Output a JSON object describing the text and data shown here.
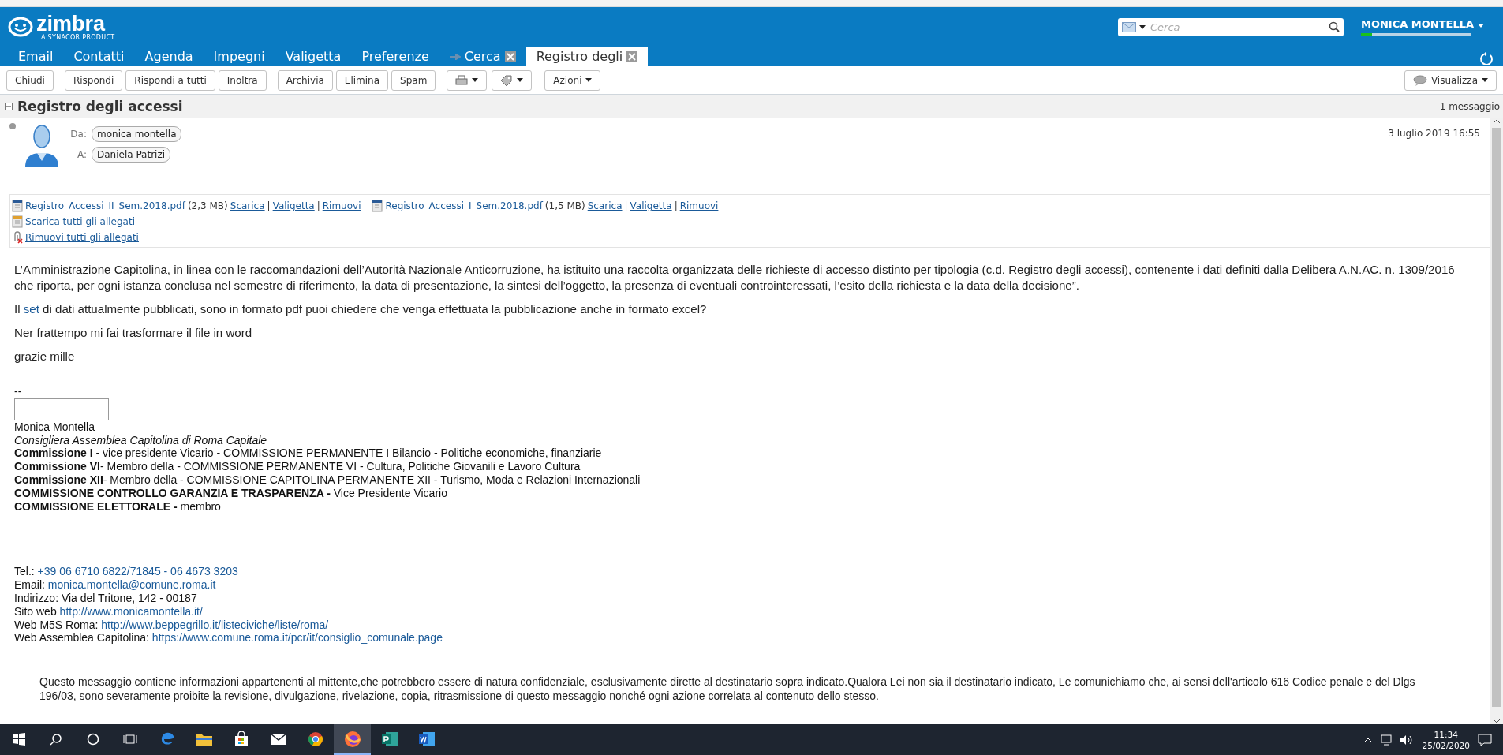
{
  "brand": {
    "name": "zimbra",
    "tagline": "A SYNACOR PRODUCT"
  },
  "search": {
    "placeholder": "Cerca"
  },
  "user": {
    "name": "MONICA MONTELLA",
    "level": 0.1
  },
  "tabs": [
    {
      "label": "Email",
      "selected": false,
      "kind": "app"
    },
    {
      "label": "Contatti",
      "selected": false,
      "kind": "app"
    },
    {
      "label": "Agenda",
      "selected": false,
      "kind": "app"
    },
    {
      "label": "Impegni",
      "selected": false,
      "kind": "app"
    },
    {
      "label": "Valigetta",
      "selected": false,
      "kind": "app"
    },
    {
      "label": "Preferenze",
      "selected": false,
      "kind": "app"
    },
    {
      "label": "Cerca",
      "selected": false,
      "kind": "search"
    },
    {
      "label": "Registro degli",
      "selected": true,
      "kind": "view"
    }
  ],
  "toolbar": {
    "groups": [
      [
        "Chiudi"
      ],
      [
        "Rispondi",
        "Rispondi a tutti",
        "Inoltra"
      ],
      [
        "Archivia",
        "Elimina",
        "Spam"
      ]
    ],
    "actions": "Azioni",
    "view": "Visualizza"
  },
  "conversation": {
    "title": "Registro degli accessi",
    "count": "1 messaggio",
    "expanded": true
  },
  "message": {
    "from_label": "Da:",
    "from": "monica montella",
    "to_label": "A:",
    "to": "Daniela Patrizi",
    "date": "3 luglio 2019 16:55"
  },
  "attachments": {
    "separator": "|",
    "files": [
      {
        "name": "Registro_Accessi_II_Sem.2018.pdf",
        "size": "(2,3 MB)",
        "links": [
          "Scarica",
          "Valigetta",
          "Rimuovi"
        ]
      },
      {
        "name": "Registro_Accessi_I_Sem.2018.pdf",
        "size": "(1,5 MB)",
        "links": [
          "Scarica",
          "Valigetta",
          "Rimuovi"
        ]
      }
    ],
    "actions": [
      {
        "label": "Scarica tutti gli allegati",
        "kind": "download"
      },
      {
        "label": "Rimuovi tutti gli allegati",
        "kind": "remove"
      }
    ]
  },
  "body": [
    {
      "before": "L’Amministrazione Capitolina, in linea con le raccomandazioni dell’Autorità Nazionale Anticorruzione, ha istituito una raccolta organizzata delle richieste di accesso distinto per tipologia (c.d. Registro degli accessi), contenente i dati definiti dalla Delibera A.N.AC. n. 1309/2016 che riporta, per ogni istanza conclusa nel semestre di riferimento, la data di presentazione, la sintesi dell’oggetto, la presenza di eventuali controinteressati, l’esito della richiesta e la data della decisione”."
    },
    {
      "before": "Il ",
      "link": "set",
      "after": " di dati attualmente pubblicati, sono in formato pdf puoi chiedere che venga effettuata la pubblicazione anche  in formato excel?"
    },
    {
      "before": "Ner frattempo mi fai trasformare il file in word"
    },
    {
      "before": "grazie mille"
    }
  ],
  "signature": {
    "separator": "--",
    "name": "Monica Montella",
    "role": "Consigliera Assemblea Capitolina di Roma Capitale",
    "lines": [
      "**Commissione I** - vice presidente Vicario - COMMISSIONE PERMANENTE I Bilancio - Politiche economiche, finanziarie",
      "**Commissione VI**- Membro della - COMMISSIONE PERMANENTE VI - Cultura, Politiche Giovanili e Lavoro Cultura",
      "**Commissione XII**- Membro della - COMMISSIONE CAPITOLINA PERMANENTE XII - Turismo, Moda e Relazioni Internazionali",
      "**COMMISSIONE CONTROLLO GARANZIA E TRASPARENZA -** Vice Presidente Vicario",
      "**COMMISSIONE ELETTORALE -** membro"
    ],
    "contacts": [
      {
        "label": "Tel.:",
        "value": "+39 06 6710 6822/71845 - 06 4673 3203",
        "kind": "link"
      },
      {
        "label": "Email:",
        "value": "monica.montella@comune.roma.it",
        "kind": "link"
      },
      {
        "label": "Indirizzo:",
        "value": "Via del Tritone, 142 - 00187",
        "kind": "text"
      },
      {
        "label": "Sito web",
        "value": "http://www.monicamontella.it/",
        "kind": "link"
      },
      {
        "label": "Web M5S Roma:",
        "value": "http://www.beppegrillo.it/listeciviche/liste/roma/",
        "kind": "link"
      },
      {
        "label": "Web Assemblea Capitolina:",
        "value": "https://www.comune.roma.it/pcr/it/consiglio_comunale.page",
        "kind": "link"
      }
    ]
  },
  "disclaimer": " Questo messaggio contiene informazioni appartenenti al mittente,che potrebbero essere di natura confidenziale, esclusivamente dirette al destinatario sopra indicato.Qualora Lei non sia il destinatario indicato, Le comunichiamo che, ai sensi dell'articolo 616 Codice penale e del Dlgs 196/03, sono severamente proibite la revisione, divulgazione, rivelazione, copia, ritrasmissione di questo messaggio nonché ogni azione correlata al contenuto dello stesso.",
  "taskbar": {
    "apps": [
      {
        "kind": "edge",
        "selected": false
      },
      {
        "kind": "folder",
        "selected": false
      },
      {
        "kind": "store",
        "selected": false
      },
      {
        "kind": "mail",
        "selected": false
      },
      {
        "kind": "chrome",
        "selected": false
      },
      {
        "kind": "firefox",
        "selected": true
      },
      {
        "kind": "publisher",
        "selected": false
      },
      {
        "kind": "word",
        "selected": false
      }
    ],
    "time": "11:34",
    "date": "25/02/2020"
  }
}
